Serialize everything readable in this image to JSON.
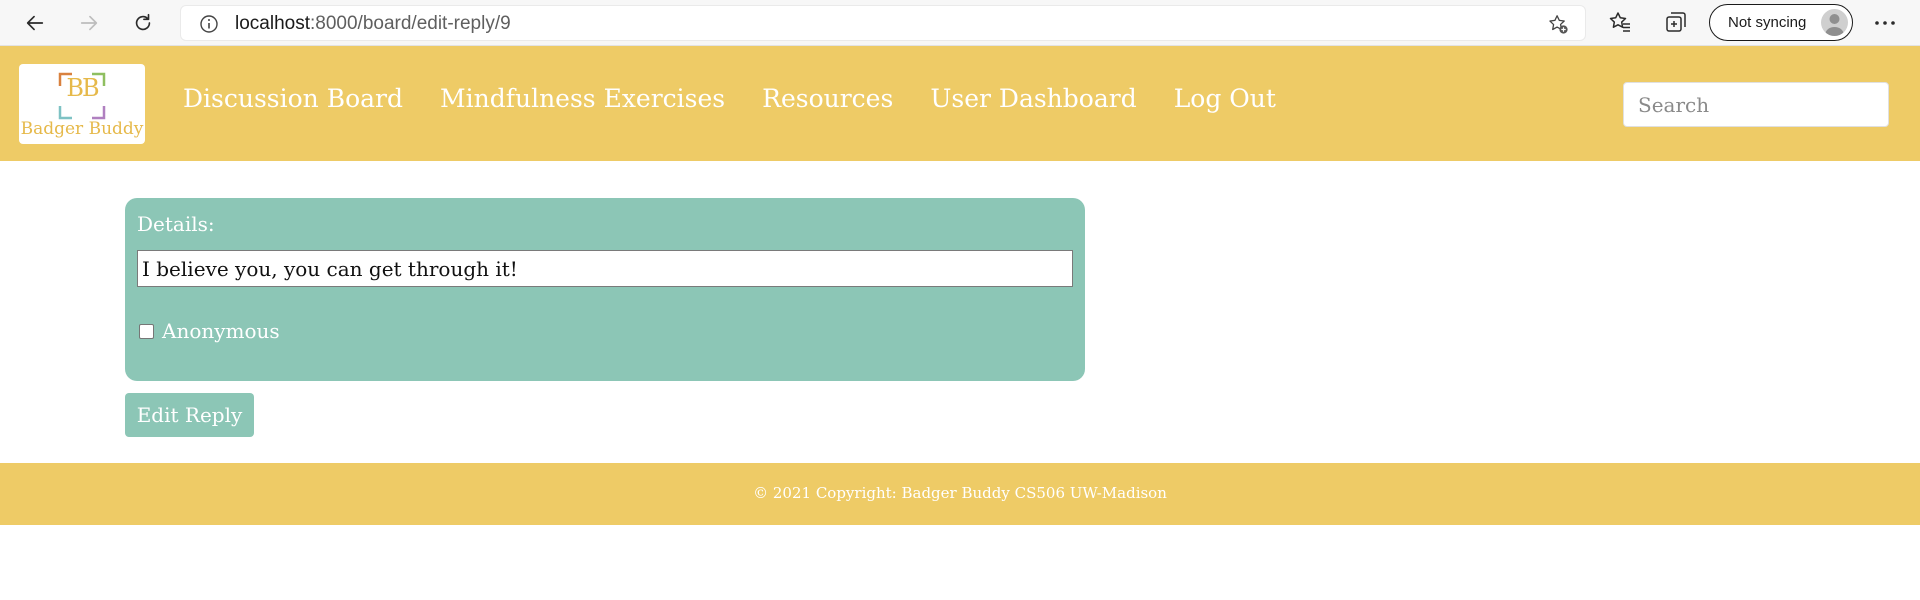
{
  "browser": {
    "url_host": "localhost",
    "url_path": ":8000/board/edit-reply/9",
    "profile_label": "Not syncing"
  },
  "header": {
    "logo_text": "Badger Buddy",
    "logo_letters": "BB",
    "nav": [
      {
        "label": "Discussion Board"
      },
      {
        "label": "Mindfulness Exercises"
      },
      {
        "label": "Resources"
      },
      {
        "label": "User Dashboard"
      },
      {
        "label": "Log Out"
      }
    ],
    "search_placeholder": "Search"
  },
  "form": {
    "details_label": "Details:",
    "details_value": "I believe you, you can get through it!",
    "anonymous_label": "Anonymous",
    "anonymous_checked": false,
    "submit_label": "Edit Reply"
  },
  "footer": {
    "copyright": "© 2021 Copyright: Badger Buddy CS506 UW-Madison"
  },
  "colors": {
    "header_bg": "#eecb66",
    "card_bg": "#8cc6b6",
    "button_bg": "#8cc6b6"
  },
  "icons": {
    "back": "arrow-left-icon",
    "forward": "arrow-right-icon",
    "reload": "reload-icon",
    "info": "info-icon",
    "favorite_add": "star-plus-icon",
    "favorites": "favorites-icon",
    "collections": "collections-icon",
    "avatar": "avatar-icon",
    "more": "more-icon"
  }
}
